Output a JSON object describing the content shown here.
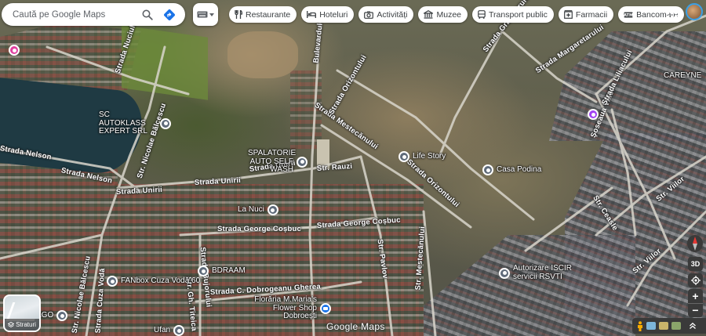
{
  "search": {
    "placeholder": "Caută pe Google Maps"
  },
  "chips": [
    {
      "label": "Restaurante",
      "icon": "fork-knife-icon"
    },
    {
      "label": "Hoteluri",
      "icon": "bed-icon"
    },
    {
      "label": "Activități",
      "icon": "camera-icon"
    },
    {
      "label": "Muzee",
      "icon": "museum-icon"
    },
    {
      "label": "Transport public",
      "icon": "bus-icon"
    },
    {
      "label": "Farmacii",
      "icon": "pharmacy-icon"
    },
    {
      "label": "Bancomate",
      "icon": "atm-icon"
    }
  ],
  "layers": {
    "label": "Straturi"
  },
  "controls": {
    "three_d": "3D",
    "zoom_in": "+",
    "zoom_out": "−"
  },
  "brand": "Google Maps",
  "roads": {
    "nuciului": "Strada Nuciului",
    "balcescu_top": "Str. Nicolae Bălcescu",
    "balcescu_bottom": "Str. Nicolae Bălcescu",
    "bulevardul": "Bulevardul",
    "nelson": "Strada Nelson",
    "unirii_1": "Strada Unirii",
    "unirii_2": "Strada Unirii",
    "unirii_3": "Strada Unirii",
    "rauzi": "Str. Rauzi",
    "mestecanului_top": "Strada Mestecănului",
    "orizontului": "Strada Orizontului",
    "orizontului_2": "Strada Orizontului",
    "george_cosbuc_1": "Strada George Coșbuc",
    "george_cosbuc_2": "Strada George Coșbuc",
    "mestecanului_bottom": "Str. Mestecănului",
    "margaretarului": "Strada Margaretarului",
    "gradinarului": "Strada Grădinarului",
    "soseaua": "Șoseaua Viilor",
    "liliacului": "Strada Liliacului",
    "viilor_bottom": "Str. Viilor",
    "ceaslei": "Str. Ceasle",
    "dobrogeanu": "Strada C. Dobrogeanu Gherea",
    "cuza_voda": "Strada Cuza Vodă",
    "gh_titeica": "Str. Gh. Titeica",
    "bujorului": "Strada Bujorului",
    "pavlov": "Str. Pavlov"
  },
  "places": {
    "autoklass": "SC AUTOKLASS EXPERT SRL",
    "spalatorie": "SPALATORIE AUTO SELF WASH",
    "life_story": "Life Story",
    "casa_podina": "Casa Podina",
    "la_nuci": "La Nuci",
    "fanbox": "FANbox Cuza Vodă 60",
    "bdraam": "BDRAAM",
    "autorizare": "Autorizare ISCIR servicii RSVTI",
    "florarie": "Florăria M.Maria's Flower Shop Dobroești",
    "careyne": "CAREYNE",
    "lago": "AGO",
    "ufan": "Ufan"
  }
}
